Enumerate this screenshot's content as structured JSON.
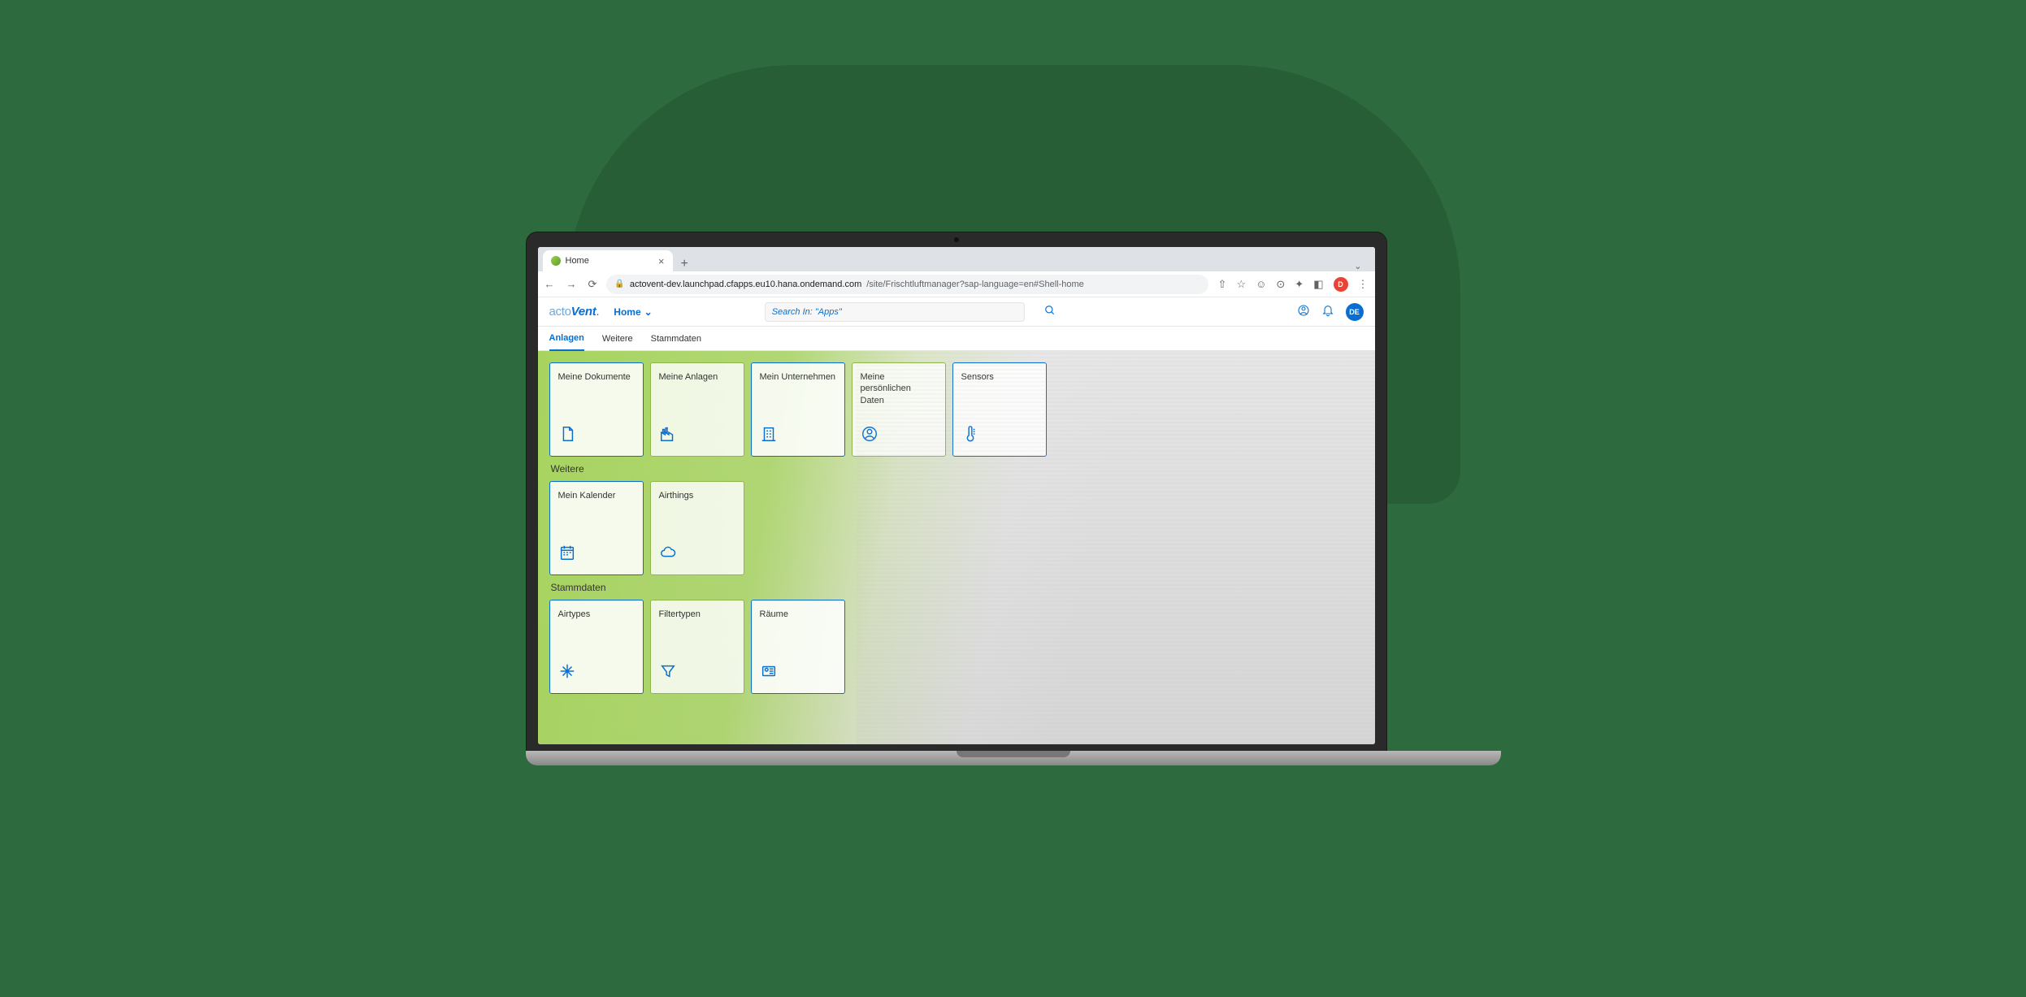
{
  "browser": {
    "tab_title": "Home",
    "url_protocol_icon": "lock",
    "url_host": "actovent-dev.launchpad.cfapps.eu10.hana.ondemand.com",
    "url_path": "/site/Frischtluftmanager?sap-language=en#Shell-home",
    "profile_initial": "D"
  },
  "header": {
    "logo_part1": "acto",
    "logo_part2": "Vent",
    "logo_dot": ".",
    "home_label": "Home",
    "search_placeholder": "Search In: \"Apps\"",
    "user_initials": "DE"
  },
  "nav": {
    "tabs": [
      {
        "label": "Anlagen",
        "active": true
      },
      {
        "label": "Weitere",
        "active": false
      },
      {
        "label": "Stammdaten",
        "active": false
      }
    ]
  },
  "sections": {
    "anlagen": {
      "tiles": [
        {
          "title": "Meine Dokumente",
          "icon": "document-icon"
        },
        {
          "title": "Meine Anlagen",
          "icon": "factory-icon"
        },
        {
          "title": "Mein Unternehmen",
          "icon": "building-icon"
        },
        {
          "title": "Meine persönlichen Daten",
          "icon": "person-icon"
        },
        {
          "title": "Sensors",
          "icon": "thermometer-icon"
        }
      ]
    },
    "weitere": {
      "title": "Weitere",
      "tiles": [
        {
          "title": "Mein Kalender",
          "icon": "calendar-icon"
        },
        {
          "title": "Airthings",
          "icon": "cloud-icon"
        }
      ]
    },
    "stammdaten": {
      "title": "Stammdaten",
      "tiles": [
        {
          "title": "Airtypes",
          "icon": "snowflake-icon"
        },
        {
          "title": "Filtertypen",
          "icon": "filter-icon"
        },
        {
          "title": "Räume",
          "icon": "room-icon"
        }
      ]
    }
  }
}
